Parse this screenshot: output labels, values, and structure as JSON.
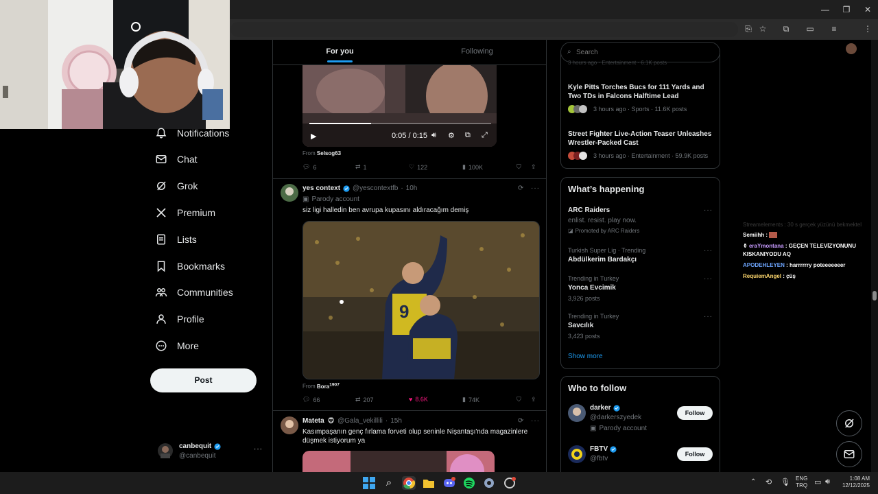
{
  "nav": {
    "items": [
      {
        "label": "Notifications",
        "icon": "bell-icon"
      },
      {
        "label": "Chat",
        "icon": "mail-icon"
      },
      {
        "label": "Grok",
        "icon": "grok-icon"
      },
      {
        "label": "Premium",
        "icon": "x-logo-icon"
      },
      {
        "label": "Lists",
        "icon": "list-icon"
      },
      {
        "label": "Bookmarks",
        "icon": "bookmark-icon"
      },
      {
        "label": "Communities",
        "icon": "people-icon"
      },
      {
        "label": "Profile",
        "icon": "person-icon"
      },
      {
        "label": "More",
        "icon": "more-circle-icon"
      }
    ],
    "post_label": "Post",
    "account": {
      "name": "canbequit",
      "handle": "@canbequit"
    }
  },
  "tabs": {
    "for_you": "For you",
    "following": "Following"
  },
  "post1": {
    "video_time": "0:05 / 0:15",
    "from_prefix": "From",
    "from_source": "Selsog63",
    "replies": "6",
    "reposts": "1",
    "likes": "122",
    "views": "100K"
  },
  "post2": {
    "name": "yes context",
    "handle": "@yescontextfb",
    "time": "10h",
    "badge": "Parody account",
    "text": "siz ligi halledin ben avrupa kupasını aldıracağım demiş",
    "from_prefix": "From",
    "from_source": "Bora",
    "from_source_sup": "1907",
    "replies": "66",
    "reposts": "207",
    "likes": "8.6K",
    "views": "74K"
  },
  "post3": {
    "name": "Mateta",
    "handle": "@Gala_vekillili",
    "time": "15h",
    "text": "Kasımpaşanın genç fırlama forveti olup seninle Nişantaşı'nda magazinlere düşmek istiyorum ya"
  },
  "search": {
    "placeholder": "Search"
  },
  "news": {
    "top_meta": "3 hours ago · Entertainment · 6.1K posts",
    "items": [
      {
        "title": "Kyle Pitts Torches Bucs for 111 Yards and Two TDs in Falcons Halftime Lead",
        "meta": "3 hours ago · Sports · 11.6K posts"
      },
      {
        "title": "Street Fighter Live-Action Teaser Unleashes Wrestler-Packed Cast",
        "meta": "3 hours ago · Entertainment · 59.9K posts"
      }
    ]
  },
  "happening": {
    "title": "What’s happening",
    "promo": {
      "title": "ARC Raiders",
      "subtitle": "enlist. resist. play now.",
      "promoted": "Promoted by ARC Raiders"
    },
    "trends": [
      {
        "category": "Turkish Super Lig · Trending",
        "title": "Abdülkerim Bardakçı",
        "posts": ""
      },
      {
        "category": "Trending in Turkey",
        "title": "Yonca Evcimik",
        "posts": "3,926 posts"
      },
      {
        "category": "Trending in Turkey",
        "title": "Savcılık",
        "posts": "3,423 posts"
      }
    ],
    "show_more": "Show more"
  },
  "who_to_follow": {
    "title": "Who to follow",
    "accounts": [
      {
        "name": "darker",
        "handle": "@darkerszyedek",
        "badge": "Parody account",
        "button": "Follow"
      },
      {
        "name": "FBTV",
        "handle": "@fbtv",
        "badge": "",
        "button": "Follow"
      }
    ]
  },
  "chat": {
    "faded": "Streamelements : 30 s gerçek yüzünü bekmektel",
    "lines": [
      {
        "user": "Semiihh",
        "msg": "",
        "color": "#ffffff"
      },
      {
        "user": "eraYmontana",
        "msg": "GEÇEN TELEVİZYONUNU KISKANIYODU AQ",
        "color": "#c79bff"
      },
      {
        "user": "APODEHLEYEN",
        "msg": "harrrrrry poteeeeeeer",
        "color": "#6ea6ff"
      },
      {
        "user": "RequiemAngel",
        "msg": "çüş",
        "color": "#ffd86e"
      }
    ]
  },
  "tray": {
    "lang1": "ENG",
    "lang2": "TRQ",
    "time": "1:08 AM",
    "date": "12/12/2025"
  },
  "colors": {
    "accent": "#1d9bf0",
    "like": "#f91880",
    "background": "#000000"
  }
}
